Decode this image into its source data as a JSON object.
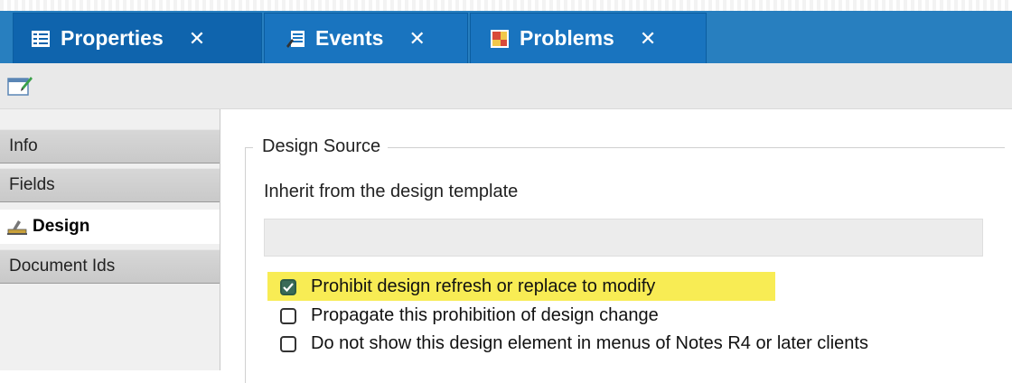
{
  "tabs": [
    {
      "label": "Properties",
      "close": "✕",
      "icon": "properties-list-icon"
    },
    {
      "label": "Events",
      "close": "✕",
      "icon": "events-icon"
    },
    {
      "label": "Problems",
      "close": "✕",
      "icon": "problems-icon"
    }
  ],
  "toolbar": {
    "icon": "edit-document-icon"
  },
  "sidebar": {
    "items": [
      {
        "label": "Info",
        "selected": false
      },
      {
        "label": "Fields",
        "selected": false
      },
      {
        "label": "Design",
        "selected": true,
        "icon": "design-icon"
      },
      {
        "label": "Document Ids",
        "selected": false
      }
    ]
  },
  "design_source": {
    "legend": "Design Source",
    "inherit_label": "Inherit from the design template",
    "inherit_value": "",
    "options": [
      {
        "label": "Prohibit design refresh or replace to modify",
        "checked": true,
        "highlighted": true
      },
      {
        "label": "Propagate this prohibition of design change",
        "checked": false
      },
      {
        "label": "Do not show this design element in menus of Notes R4 or later clients",
        "checked": false
      }
    ]
  },
  "colors": {
    "tab_bar": "#0a6db6",
    "highlight": "#f8ec54",
    "checkbox_checked": "#3a6b58"
  }
}
